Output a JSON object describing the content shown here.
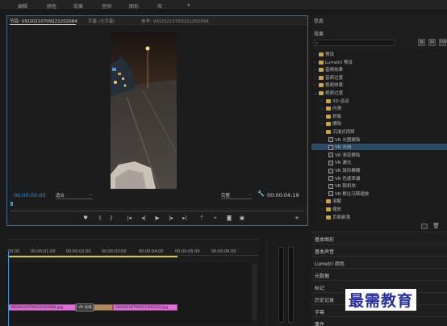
{
  "menu": {
    "items": [
      "编辑",
      "颜色",
      "效果",
      "音频",
      "图形",
      "库"
    ],
    "more": "»"
  },
  "monitor": {
    "tabs": [
      "节目: VID20210709221202084",
      "字幕 (无字幕)",
      "参考: VID20210709221202084"
    ],
    "timecode_current": "00:00:00:00",
    "fit": "适合",
    "quality": "完整",
    "timecode_duration": "00:00:04:19",
    "transport": [
      "marker",
      "in-point",
      "out-point",
      "go-to-in",
      "step-back",
      "play",
      "step-forward",
      "go-to-out",
      "lift",
      "extract",
      "export-frame",
      "comparison",
      "add"
    ]
  },
  "right_panel": {
    "top_header": "信息",
    "effects_header": "效果",
    "effects_tree": [
      {
        "label": "预设",
        "type": "folder",
        "level": 0
      },
      {
        "label": "Lumetri 预设",
        "type": "folder",
        "level": 0
      },
      {
        "label": "音频效果",
        "type": "folder",
        "level": 0
      },
      {
        "label": "音频过渡",
        "type": "folder",
        "level": 0
      },
      {
        "label": "视频效果",
        "type": "folder",
        "level": 0
      },
      {
        "label": "视频过渡",
        "type": "folder",
        "level": 0,
        "open": true
      },
      {
        "label": "3D 运动",
        "type": "folder",
        "level": 1
      },
      {
        "label": "内滑",
        "type": "folder",
        "level": 1
      },
      {
        "label": "划像",
        "type": "folder",
        "level": 1
      },
      {
        "label": "擦除",
        "type": "folder",
        "level": 1
      },
      {
        "label": "沉浸式视频",
        "type": "folder",
        "level": 1,
        "open": true
      },
      {
        "label": "VR 光圈擦除",
        "type": "fx",
        "level": 2
      },
      {
        "label": "VR 光线",
        "type": "fx",
        "level": 2,
        "selected": true
      },
      {
        "label": "VR 渐变擦除",
        "type": "fx",
        "level": 2
      },
      {
        "label": "VR 漏光",
        "type": "fx",
        "level": 2
      },
      {
        "label": "VR 球形模糊",
        "type": "fx",
        "level": 2
      },
      {
        "label": "VR 色度泄漏",
        "type": "fx",
        "level": 2
      },
      {
        "label": "VR 随机块",
        "type": "fx",
        "level": 2
      },
      {
        "label": "VR 默比乌斯缩放",
        "type": "fx",
        "level": 2
      },
      {
        "label": "溶解",
        "type": "folder",
        "level": 1
      },
      {
        "label": "缩放",
        "type": "folder",
        "level": 1
      },
      {
        "label": "页面剥落",
        "type": "folder",
        "level": 1
      }
    ],
    "sections": [
      "基本图形",
      "基本声音",
      "Lumetri 颜色",
      "元数据",
      "标记",
      "历史记录",
      "字幕",
      "事件"
    ]
  },
  "timeline": {
    "ruler": [
      "00:00",
      "00:00:01:00",
      "00:00:02:00",
      "00:00:03:00",
      "00:00:04:00",
      "00:00:05:00",
      "00:00:06:00"
    ],
    "clip1": "VID20210709221202084.jpg",
    "transition": "VR 光线",
    "clip2": "VID20210709221202253.jpg"
  },
  "watermark": "最需教育",
  "colors": {
    "accent": "#3d8fd6",
    "clip": "#e06ed6",
    "workbar": "#d7c45b",
    "selection": "#2c4a63"
  }
}
